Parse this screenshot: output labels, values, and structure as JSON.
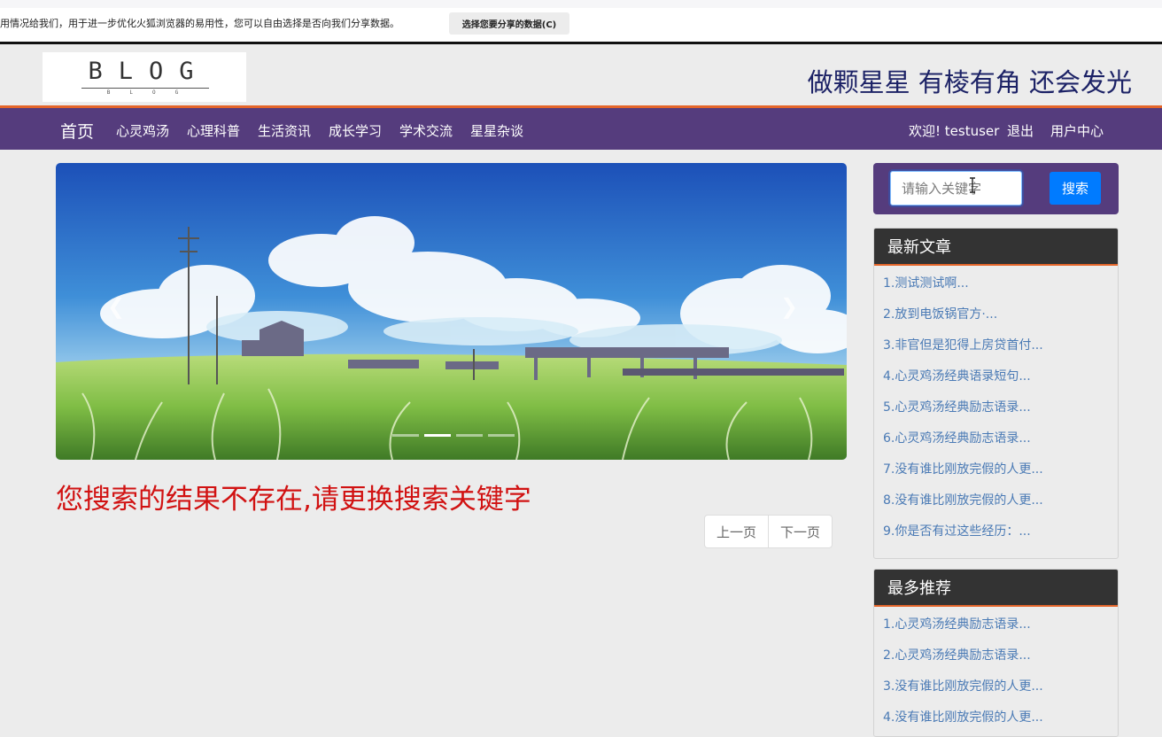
{
  "notice": {
    "text": "用情况给我们，用于进一步优化火狐浏览器的易用性，您可以自由选择是否向我们分享数据。",
    "button_label": "选择您要分享的数据(C)"
  },
  "header": {
    "logo_text": "BLOG",
    "logo_sub": "BLOG",
    "slogan": "做颗星星 有棱有角 还会发光"
  },
  "nav": {
    "home": "首页",
    "items": [
      {
        "label": "心灵鸡汤"
      },
      {
        "label": "心理科普"
      },
      {
        "label": "生活资讯"
      },
      {
        "label": "成长学习"
      },
      {
        "label": "学术交流"
      },
      {
        "label": "星星杂谈"
      }
    ],
    "welcome": "欢迎! testuser",
    "logout": "退出",
    "user_center": "用户中心"
  },
  "carousel": {
    "prev_icon": "chevron-left-icon",
    "next_icon": "chevron-right-icon",
    "active_index": 1,
    "slide_count": 5
  },
  "main": {
    "result_message": "您搜索的结果不存在,请更换搜索关键字",
    "prev_page": "上一页",
    "next_page": "下一页"
  },
  "search": {
    "placeholder": "请输入关键字",
    "button_label": "搜索"
  },
  "latest": {
    "title": "最新文章",
    "items": [
      "1.测试测试啊...",
      "2.放到电饭锅官方·...",
      "3.非官但是犯得上房贷首付...",
      "4.心灵鸡汤经典语录短句...",
      "5.心灵鸡汤经典励志语录...",
      "6.心灵鸡汤经典励志语录...",
      "7.没有谁比刚放完假的人更...",
      "8.没有谁比刚放完假的人更...",
      "9.你是否有过这些经历：..."
    ]
  },
  "recommended": {
    "title": "最多推荐",
    "items": [
      "1.心灵鸡汤经典励志语录...",
      "2.心灵鸡汤经典励志语录...",
      "3.没有谁比刚放完假的人更...",
      "4.没有谁比刚放完假的人更..."
    ]
  },
  "colors": {
    "nav_bg": "#553c7d",
    "accent": "#e4652a",
    "slogan": "#1c2266",
    "error": "#d11212",
    "link": "#4a7ab5",
    "search_button": "#007bff"
  }
}
